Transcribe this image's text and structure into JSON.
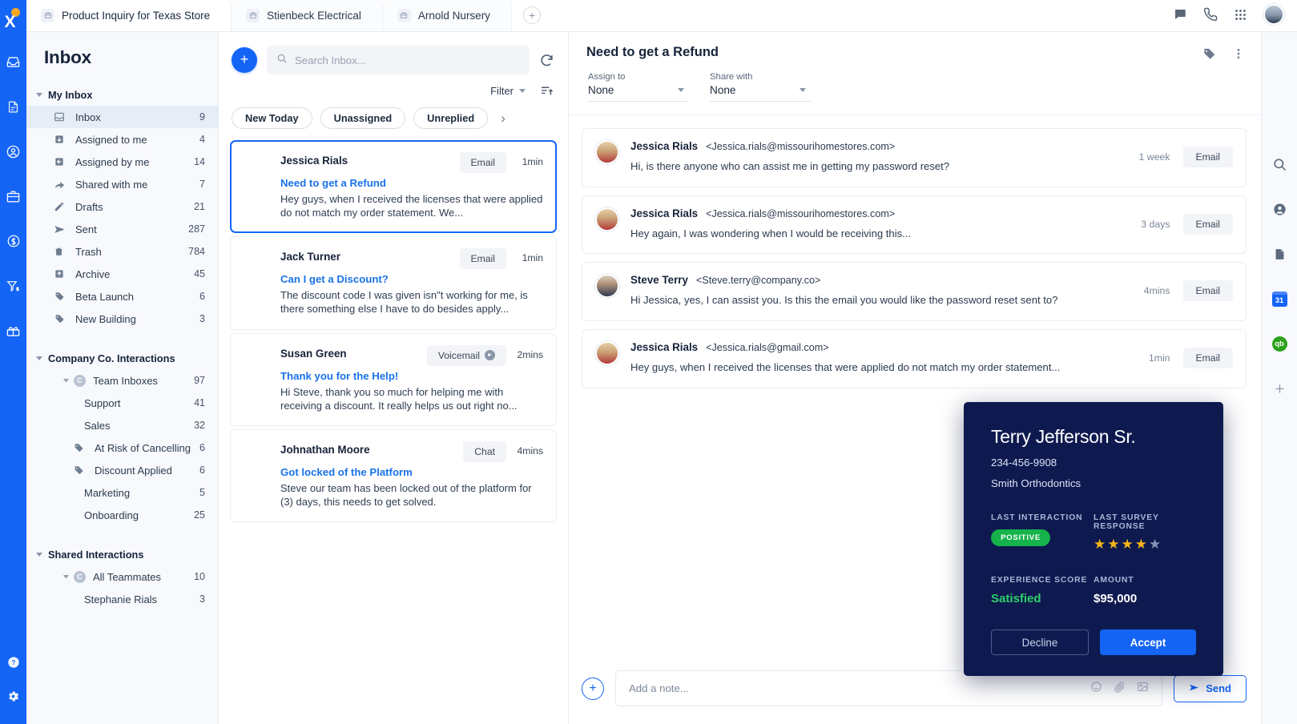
{
  "brand": {
    "accent": "#1464f6",
    "link": "#1a73e8",
    "card_bg": "#0e1a4f",
    "positive": "#16b24b",
    "star": "#f5b518"
  },
  "topbar": {
    "tabs": [
      {
        "label": "Product Inquiry for Texas Store",
        "icon": "briefcase-icon"
      },
      {
        "label": "Stienbeck Electrical",
        "icon": "briefcase-icon"
      },
      {
        "label": "Arnold Nursery",
        "icon": "briefcase-icon"
      }
    ],
    "add_tab": "+",
    "actions": [
      "chat-icon",
      "phone-icon",
      "apps-grid-icon",
      "user-avatar"
    ]
  },
  "rail": {
    "logo": "x-logo",
    "icons": [
      "inbox-icon",
      "document-icon",
      "contact-icon",
      "briefcase-icon",
      "dollar-circle-icon",
      "funnel-dollar-icon",
      "gift-icon"
    ],
    "bottom_icons": [
      "help-icon",
      "gear-icon"
    ]
  },
  "sidebar": {
    "title": "Inbox",
    "groups": [
      {
        "label": "My Inbox",
        "items": [
          {
            "label": "Inbox",
            "count": "9",
            "icon": "inbox-square-icon",
            "active": true
          },
          {
            "label": "Assigned to me",
            "count": "4",
            "icon": "assigned-to-icon"
          },
          {
            "label": "Assigned by me",
            "count": "14",
            "icon": "assigned-by-icon"
          },
          {
            "label": "Shared with me",
            "count": "7",
            "icon": "share-arrow-icon"
          },
          {
            "label": "Drafts",
            "count": "21",
            "icon": "pencil-icon"
          },
          {
            "label": "Sent",
            "count": "287",
            "icon": "send-icon"
          },
          {
            "label": "Trash",
            "count": "784",
            "icon": "trash-icon"
          },
          {
            "label": "Archive",
            "count": "45",
            "icon": "archive-icon"
          },
          {
            "label": "Beta Launch",
            "count": "6",
            "icon": "tag-icon"
          },
          {
            "label": "New Building",
            "count": "3",
            "icon": "tag-icon"
          }
        ]
      },
      {
        "label": "Company Co. Interactions",
        "items": [
          {
            "label": "Team Inboxes",
            "count": "97",
            "icon": "circle-c-icon",
            "expandable": true
          },
          {
            "label": "Support",
            "count": "41",
            "icon": "none",
            "nested": true
          },
          {
            "label": "Sales",
            "count": "32",
            "icon": "none",
            "nested": true
          },
          {
            "label": "At Risk of Cancelling",
            "count": "6",
            "icon": "tag-icon"
          },
          {
            "label": "Discount Applied",
            "count": "6",
            "icon": "tag-icon"
          },
          {
            "label": "Marketing",
            "count": "5",
            "icon": "none",
            "nested": true
          },
          {
            "label": "Onboarding",
            "count": "25",
            "icon": "none",
            "nested": true
          }
        ]
      },
      {
        "label": "Shared Interactions",
        "items": [
          {
            "label": "All Teammates",
            "count": "10",
            "icon": "circle-c-icon",
            "expandable": true
          },
          {
            "label": "Stephanie Rials",
            "count": "3",
            "icon": "none",
            "nested": true
          }
        ]
      }
    ]
  },
  "list": {
    "new_button": "+",
    "search_placeholder": "Search Inbox...",
    "search_value": "",
    "filter_label": "Filter",
    "chips": [
      "New Today",
      "Unassigned",
      "Unreplied"
    ],
    "conversations": [
      {
        "name": "Jessica Rials",
        "badge": "Email",
        "badge_icon": "none",
        "time": "1min",
        "subject": "Need to get a Refund",
        "preview": "Hey guys, when I received the licenses that were applied do not match my order statement. We...",
        "selected": true
      },
      {
        "name": "Jack Turner",
        "badge": "Email",
        "badge_icon": "none",
        "time": "1min",
        "subject": "Can I get a Discount?",
        "preview": "The discount code I was given isn\"t working for me, is there something else I have to do besides apply...",
        "selected": false
      },
      {
        "name": "Susan Green",
        "badge": "Voicemail",
        "badge_icon": "play-icon",
        "time": "2mins",
        "subject": "Thank you for the Help!",
        "preview": "Hi Steve, thank you so much for helping me with receiving a discount. It really helps us out right no...",
        "selected": false
      },
      {
        "name": "Johnathan Moore",
        "badge": "Chat",
        "badge_icon": "none",
        "time": "4mins",
        "subject": "Got locked of the Platform",
        "preview": "Steve our team has been locked out of the platform for (3) days, this needs to get solved.",
        "selected": false
      }
    ]
  },
  "conversation": {
    "title": "Need to get a Refund",
    "header_icons": [
      "tag-icon",
      "more-vertical-icon"
    ],
    "assign_to": {
      "label": "Assign to",
      "value": "None"
    },
    "share_with": {
      "label": "Share with",
      "value": "None"
    },
    "messages": [
      {
        "name": "Jessica Rials",
        "email": "<Jessica.rials@missourihomestores.com>",
        "time": "1 week",
        "badge": "Email",
        "text": "Hi, is there anyone who can assist me in getting my password reset?",
        "avatar": "female-avatar"
      },
      {
        "name": "Jessica Rials",
        "email": "<Jessica.rials@missourihomestores.com>",
        "time": "3 days",
        "badge": "Email",
        "text": "Hey again, I was wondering when I would be receiving this...",
        "avatar": "female-avatar"
      },
      {
        "name": "Steve Terry",
        "email": "<Steve.terry@company.co>",
        "time": "4mins",
        "badge": "Email",
        "text": "Hi Jessica, yes, I can assist you.  Is this the email you would like the password reset sent to?",
        "avatar": "male-avatar"
      },
      {
        "name": "Jessica Rials",
        "email": "<Jessica.rials@gmail.com>",
        "time": "1min",
        "badge": "Email",
        "text": "Hey guys, when I received the licenses that were applied do not match my order statement...",
        "avatar": "female-avatar"
      }
    ],
    "composer": {
      "add": "+",
      "placeholder": "Add a note...",
      "send_label": "Send"
    }
  },
  "right_rail": {
    "icons": [
      "search-icon",
      "contact-icon",
      "document-icon",
      "calendar-icon",
      "quickbooks-icon",
      "plus-icon"
    ],
    "calendar_day": "31",
    "quickbooks_label": "qb"
  },
  "contact_card": {
    "name": "Terry Jefferson Sr.",
    "phone": "234-456-9908",
    "company": "Smith Orthodontics",
    "last_interaction_label": "LAST INTERACTION",
    "last_interaction_value": "POSITIVE",
    "last_survey_label": "LAST SURVEY RESPONSE",
    "stars_filled": 4,
    "stars_total": 5,
    "experience_label": "EXPERIENCE SCORE",
    "experience_value": "Satisfied",
    "amount_label": "AMOUNT",
    "amount_value": "$95,000",
    "decline_label": "Decline",
    "accept_label": "Accept"
  }
}
